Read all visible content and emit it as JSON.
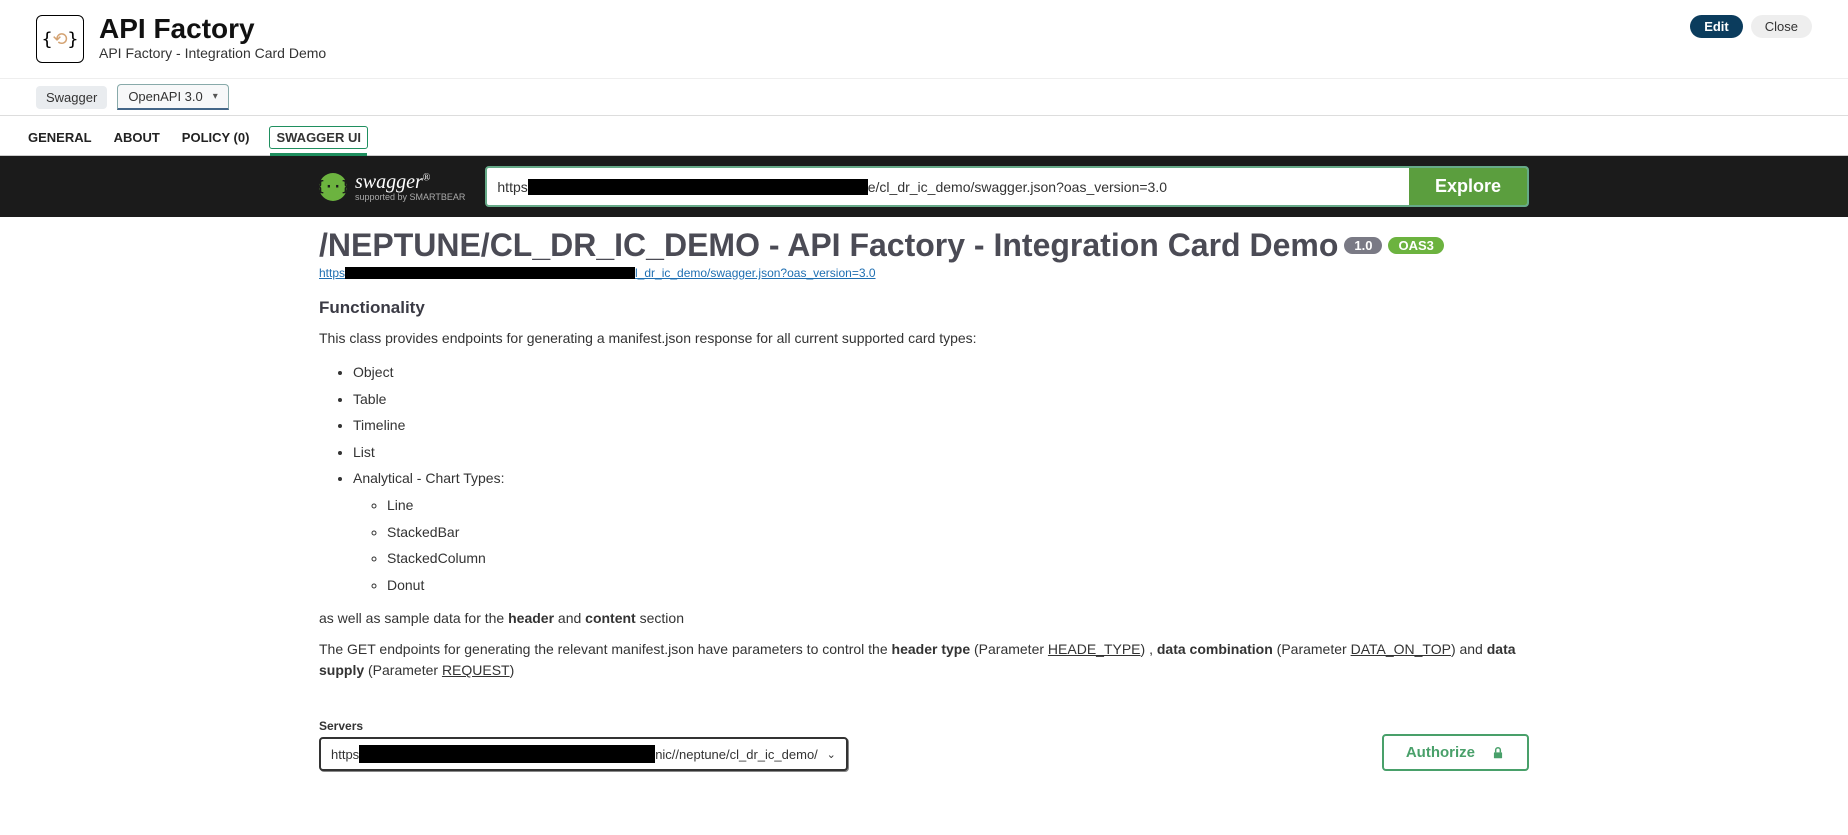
{
  "header": {
    "title": "API Factory",
    "subtitle": "API Factory - Integration Card Demo",
    "edit": "Edit",
    "close": "Close"
  },
  "subbar": {
    "chip": "Swagger",
    "select": "OpenAPI 3.0"
  },
  "tabs": {
    "general": "GENERAL",
    "about": "ABOUT",
    "policy": "POLICY (0)",
    "swaggerui": "SWAGGER UI"
  },
  "swagger": {
    "logo_text": "swagger",
    "supported": "supported by SMARTBEAR",
    "url_prefix": "https",
    "url_suffix": "e/cl_dr_ic_demo/swagger.json?oas_version=3.0",
    "explore": "Explore"
  },
  "api": {
    "title": "/NEPTUNE/CL_DR_IC_DEMO - API Factory - Integration Card Demo",
    "version": "1.0",
    "oas": "OAS3",
    "link_prefix": "https",
    "link_suffix": "l_dr_ic_demo/swagger.json?oas_version=3.0"
  },
  "desc": {
    "functionality": "Functionality",
    "intro": "This class provides endpoints for generating a manifest.json response for all current supported card types:",
    "cards": {
      "object": "Object",
      "table": "Table",
      "timeline": "Timeline",
      "list": "List",
      "analytical": "Analytical - Chart Types:",
      "line": "Line",
      "stackedbar": "StackedBar",
      "stackedcolumn": "StackedColumn",
      "donut": "Donut"
    },
    "sample_pre": "as well as sample data for the ",
    "sample_header": "header",
    "sample_and": " and ",
    "sample_content": "content",
    "sample_section": " section",
    "params_pre": "The GET endpoints for generating the relevant manifest.json have parameters to control the ",
    "params_headertype": "header type",
    "params_param1": " (Parameter ",
    "params_heade": "HEADE_TYPE",
    "params_close1": ") , ",
    "params_datacomb": "data combination",
    "params_param2": " (Parameter ",
    "params_dataontop": "DATA_ON_TOP",
    "params_close2": ") and ",
    "params_datasupply": "data supply",
    "params_param3": " (Parameter ",
    "params_request": "REQUEST",
    "params_close3": ")"
  },
  "servers": {
    "label": "Servers",
    "value_prefix": "https",
    "value_suffix": "nic//neptune/cl_dr_ic_demo/"
  },
  "authorize": "Authorize"
}
